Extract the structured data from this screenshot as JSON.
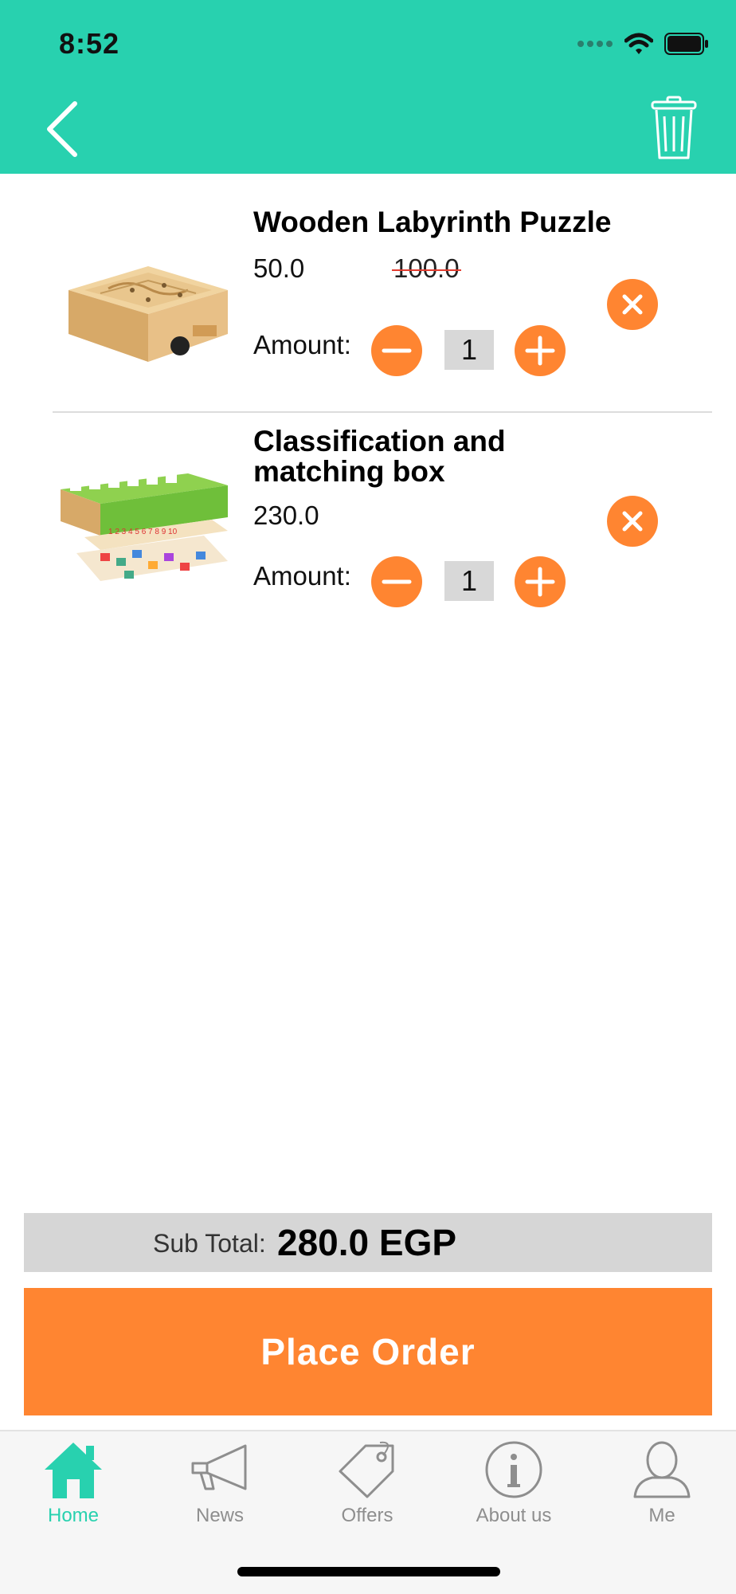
{
  "status_bar": {
    "time": "8:52"
  },
  "colors": {
    "accent": "#28d1af",
    "orange": "#ff8531",
    "strike": "#e23b2e"
  },
  "header": {
    "back_icon": "chevron-left-icon",
    "trash_icon": "trash-icon"
  },
  "cart": {
    "items": [
      {
        "name": "Wooden Labyrinth Puzzle",
        "price": "50.0",
        "old_price": "100.0",
        "amount_label": "Amount:",
        "quantity": "1"
      },
      {
        "name": "Classification and matching box",
        "price": "230.0",
        "amount_label": "Amount:",
        "quantity": "1"
      }
    ]
  },
  "summary": {
    "subtotal_label": "Sub Total:",
    "subtotal_value": "280.0 EGP"
  },
  "place_order_label": "Place Order",
  "tabbar": {
    "tabs": [
      {
        "label": "Home",
        "icon": "home-icon",
        "active": true
      },
      {
        "label": "News",
        "icon": "megaphone-icon"
      },
      {
        "label": "Offers",
        "icon": "tag-icon"
      },
      {
        "label": "About us",
        "icon": "info-icon"
      },
      {
        "label": "Me",
        "icon": "person-icon"
      }
    ]
  }
}
